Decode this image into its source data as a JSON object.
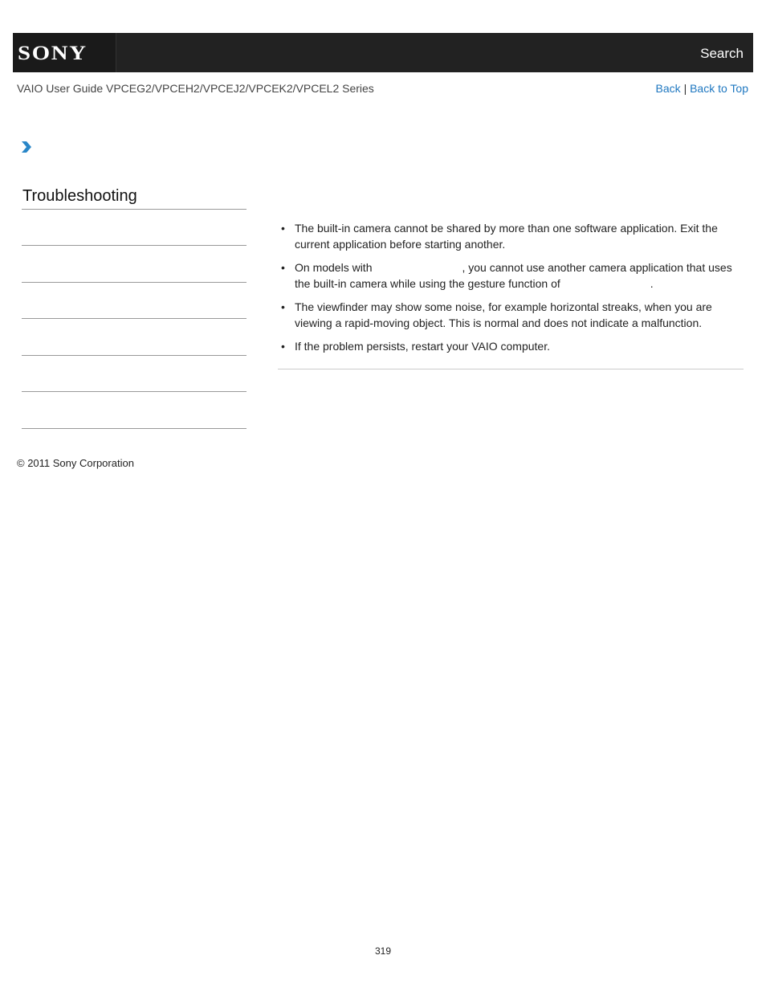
{
  "header": {
    "logo": "SONY",
    "search_label": "Search"
  },
  "subheader": {
    "guide_title": "VAIO User Guide VPCEG2/VPCEH2/VPCEJ2/VPCEK2/VPCEL2 Series",
    "back_label": "Back",
    "separator": "|",
    "back_to_top_label": "Back to Top"
  },
  "breadcrumb": {
    "icon": "chevron-right-icon"
  },
  "sidebar": {
    "title": "Troubleshooting"
  },
  "content": {
    "bullets": [
      {
        "text": "The built-in camera cannot be shared by more than one software application. Exit the current application before starting another."
      },
      {
        "part1": "On models with",
        "part2": ", you cannot use another camera application that uses the built-in camera while using the gesture function of",
        "part3": "."
      },
      {
        "text": "The viewfinder may show some noise, for example horizontal streaks, when you are viewing a rapid-moving object. This is normal and does not indicate a malfunction."
      },
      {
        "text": "If the problem persists, restart your VAIO computer."
      }
    ],
    "bullet_glyph": "•"
  },
  "footer": {
    "copyright": "© 2011 Sony Corporation",
    "page_number": "319"
  },
  "colors": {
    "header_bg": "#222222",
    "link": "#1e77c0",
    "chevron": "#2a87c8"
  }
}
